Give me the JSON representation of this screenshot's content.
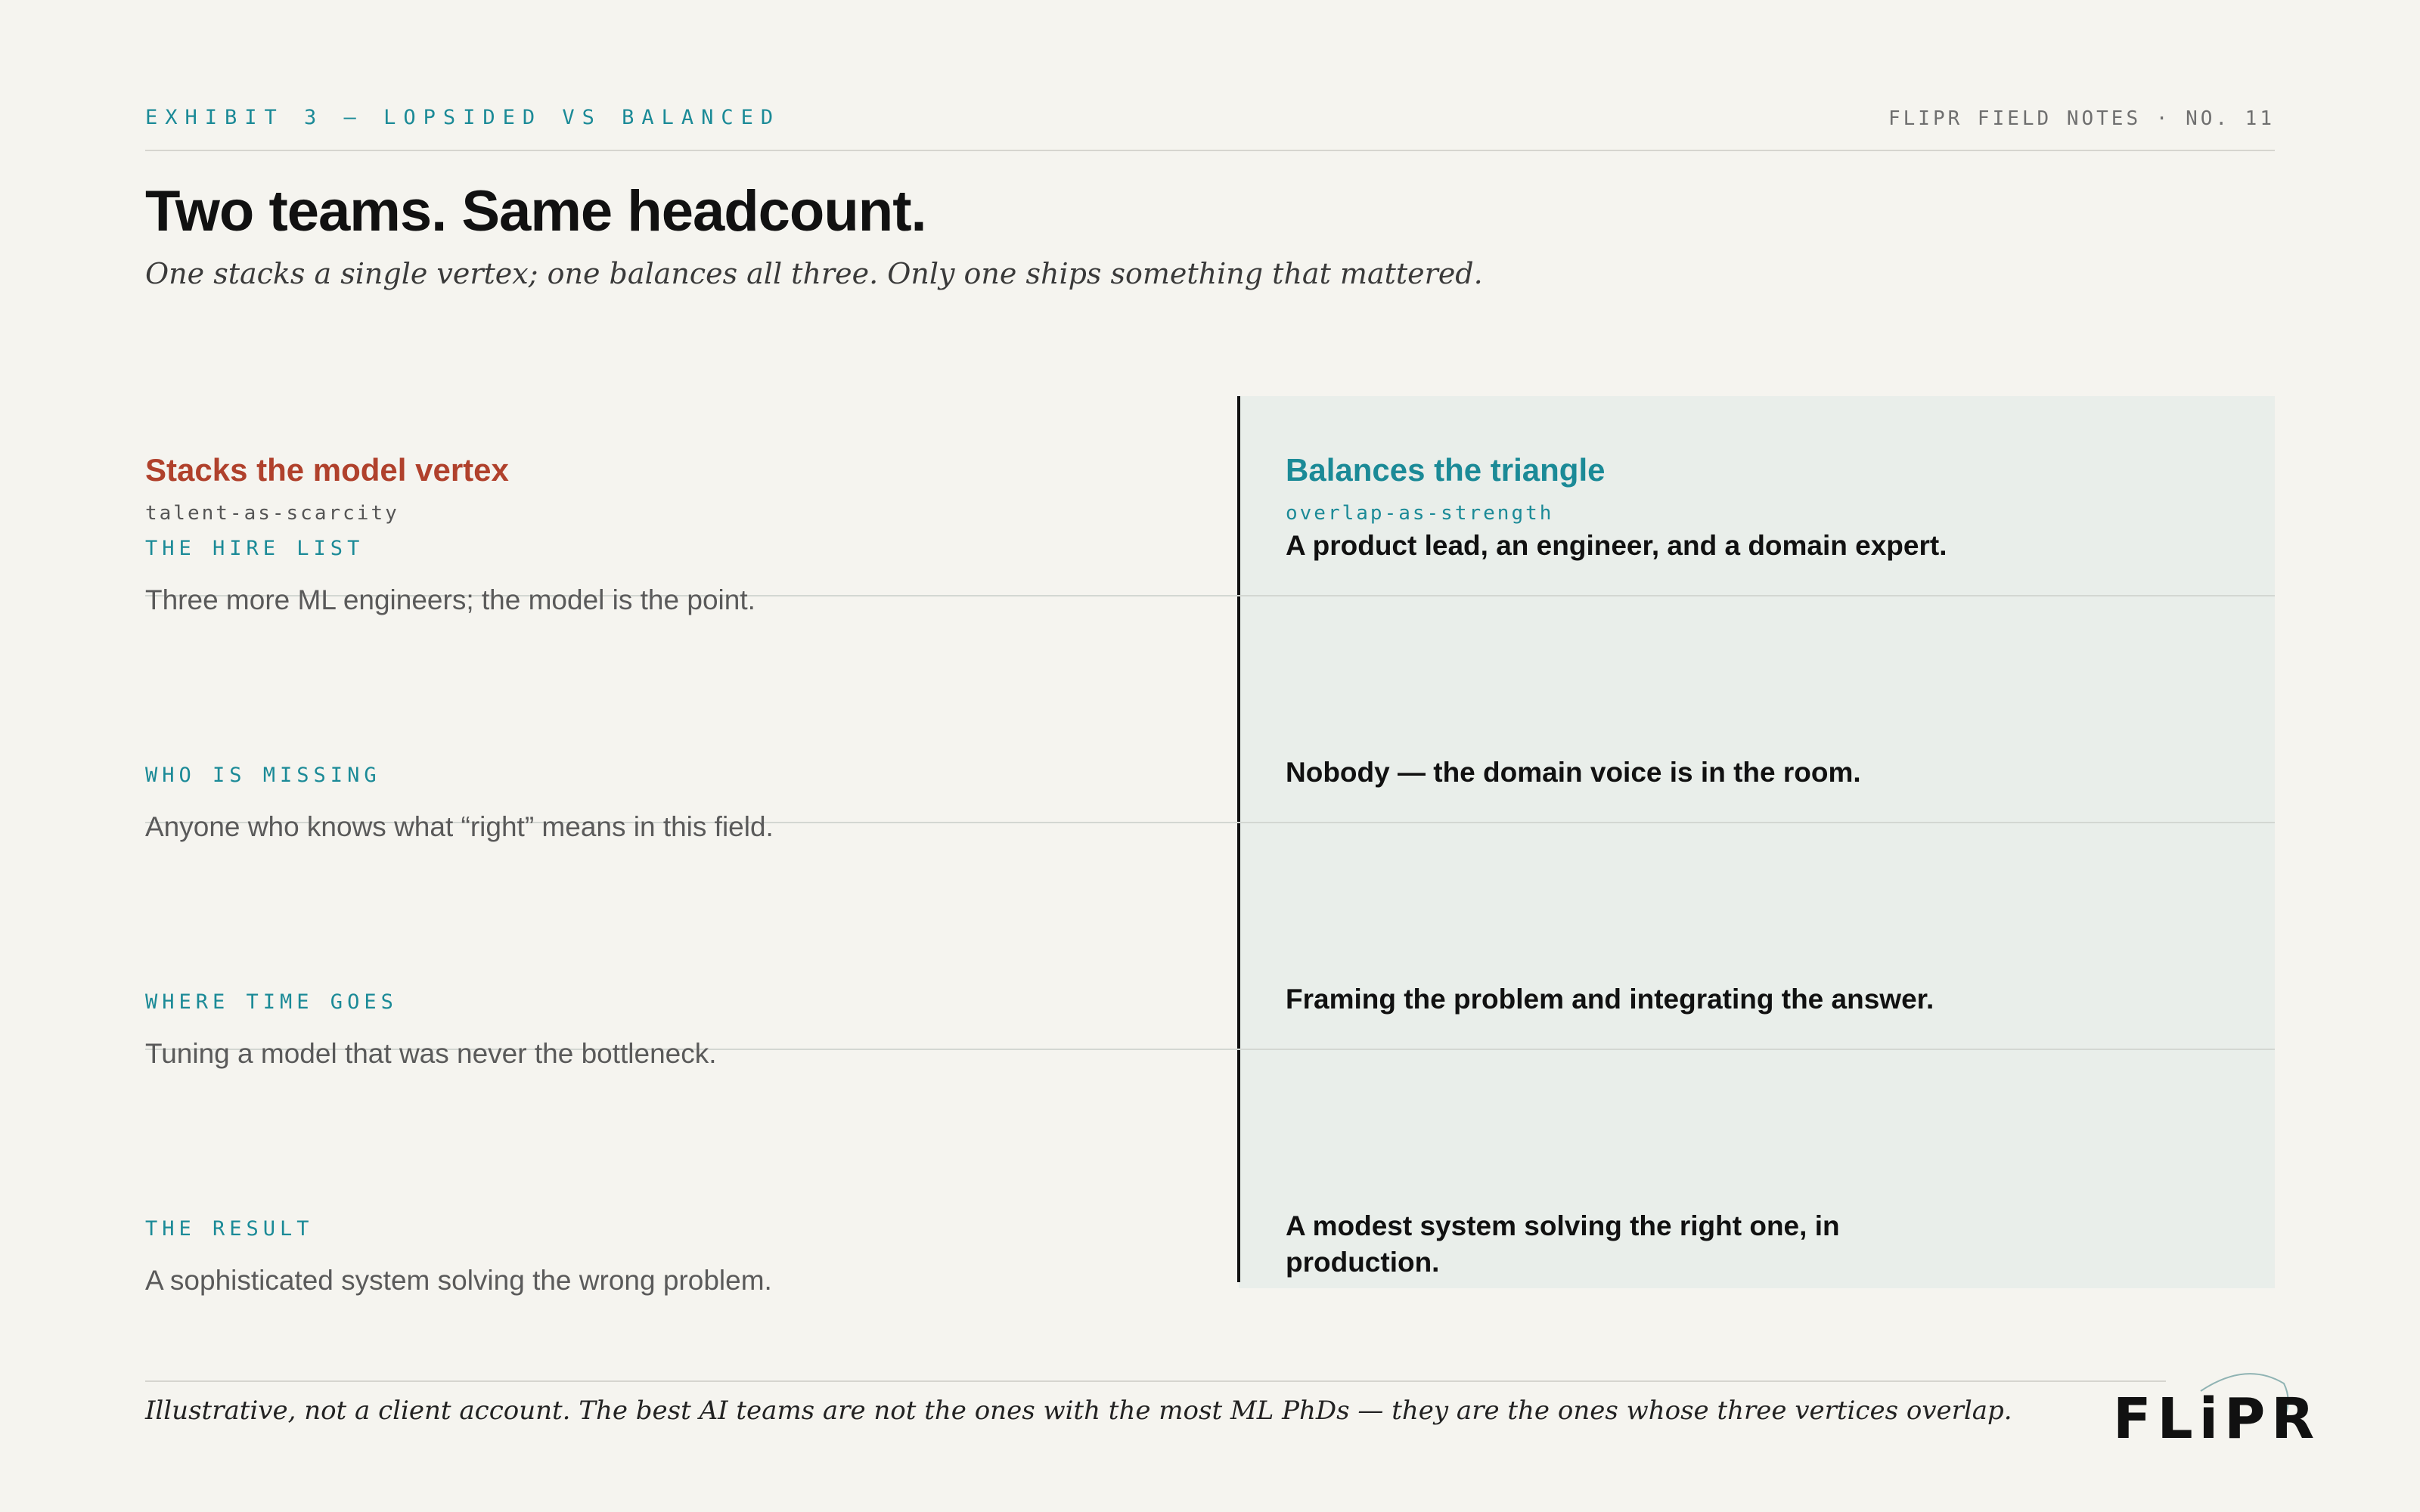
{
  "header": {
    "exhibit": "EXHIBIT 3 — LOPSIDED VS BALANCED",
    "series": "FLIPR FIELD NOTES · NO. 11",
    "title": "Two teams. Same headcount.",
    "subtitle": "One stacks a single vertex; one balances all three. Only one ships something that mattered."
  },
  "left_column": {
    "heading": "Stacks the model vertex",
    "tag": "talent-as-scarcity"
  },
  "right_column": {
    "heading": "Balances the triangle",
    "tag": "overlap-as-strength"
  },
  "rows": [
    {
      "label": "THE HIRE LIST",
      "left": "Three more ML engineers; the model is the point.",
      "right": "A product lead, an engineer, and a domain expert."
    },
    {
      "label": "WHO IS MISSING",
      "left": "Anyone who knows what “right” means in this field.",
      "right": "Nobody — the domain voice is in the room."
    },
    {
      "label": "WHERE TIME GOES",
      "left": "Tuning a model that was never the bottleneck.",
      "right": "Framing the problem and integrating the answer."
    },
    {
      "label": "THE RESULT",
      "left": "A sophisticated system solving the wrong problem.",
      "right": "A modest system solving the right one, in production."
    }
  ],
  "footer": {
    "note": "Illustrative, not a client account. The best AI teams are not the ones with the most ML PhDs — they are the ones whose three vertices overlap.",
    "logo_text": "FLiPR"
  },
  "colors": {
    "background": "#f5f4ef",
    "accent_teal": "#1b8a97",
    "accent_red": "#b0412c",
    "panel": "#e9eeea"
  }
}
